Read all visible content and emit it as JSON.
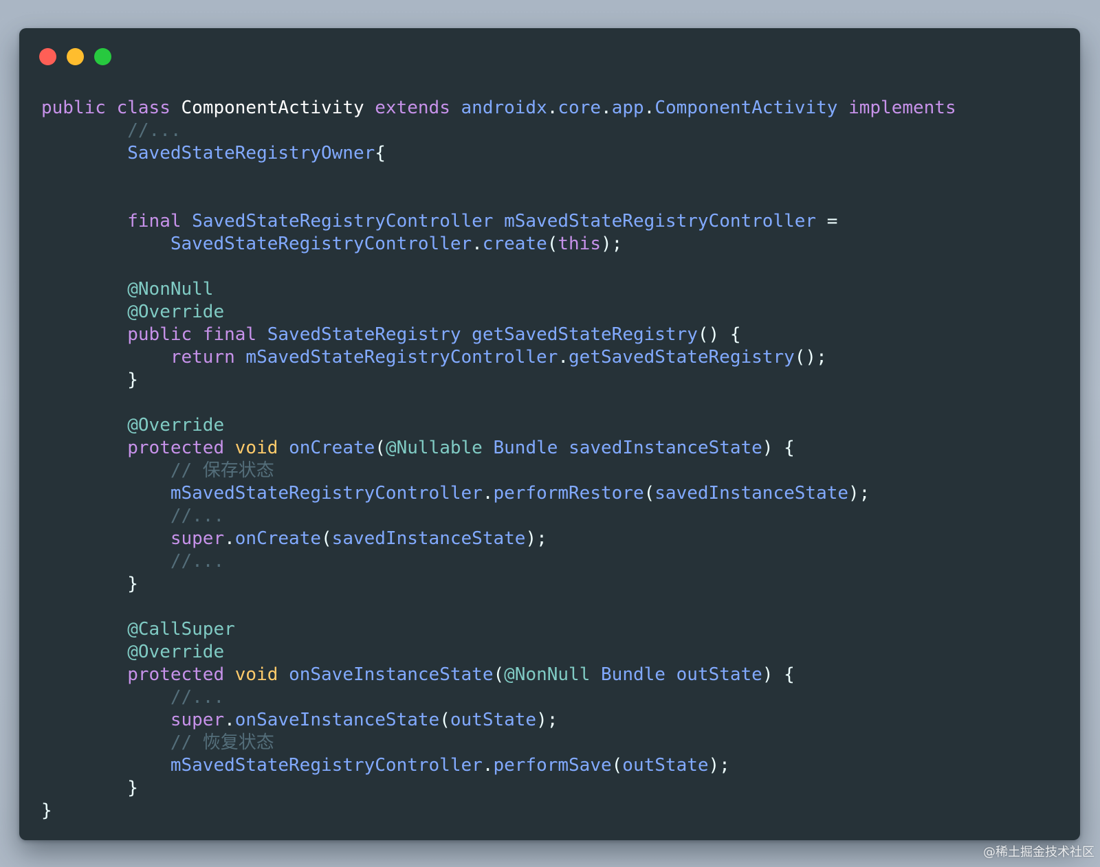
{
  "window": {
    "controls": [
      "close",
      "minimize",
      "maximize"
    ],
    "colors": {
      "background": "#263238",
      "keyword": "#c792ea",
      "type": "#82aaff",
      "annotation": "#80cbc4",
      "void": "#ffcb6b",
      "comment": "#546e7a",
      "plain": "#eeffff"
    }
  },
  "code": {
    "l1": {
      "public": "public",
      "class": "class",
      "name": "ComponentActivity",
      "extends": "extends",
      "pkg1": "androidx",
      "dot1": ".",
      "pkg2": "core",
      "dot2": ".",
      "pkg3": "app",
      "dot3": ".",
      "super_name": "ComponentActivity",
      "implements": "implements"
    },
    "l2": {
      "comment": "//..."
    },
    "l3": {
      "type": "SavedStateRegistryOwner",
      "brace": "{"
    },
    "l4": {
      "final": "final",
      "type": "SavedStateRegistryController",
      "var": "mSavedStateRegistryController",
      "eq": "="
    },
    "l5": {
      "type": "SavedStateRegistryController",
      "dot": ".",
      "fn": "create",
      "open": "(",
      "this": "this",
      "close": ");"
    },
    "l6": {
      "annotation": "@NonNull"
    },
    "l7": {
      "annotation": "@Override"
    },
    "l8": {
      "public": "public",
      "final": "final",
      "type": "SavedStateRegistry",
      "fn": "getSavedStateRegistry",
      "rest": "() {"
    },
    "l9": {
      "return": "return",
      "var": "mSavedStateRegistryController",
      "dot": ".",
      "fn": "getSavedStateRegistry",
      "rest": "();"
    },
    "l10": {
      "brace": "}"
    },
    "l11": {
      "annotation": "@Override"
    },
    "l12": {
      "protected": "protected",
      "void": "void",
      "fn": "onCreate",
      "open": "(",
      "annotation": "@Nullable",
      "type": "Bundle",
      "param": "savedInstanceState",
      "rest": ") {"
    },
    "l13": {
      "comment": "// 保存状态"
    },
    "l14": {
      "var": "mSavedStateRegistryController",
      "dot": ".",
      "fn": "performRestore",
      "open": "(",
      "param": "savedInstanceState",
      "close": ");"
    },
    "l15": {
      "comment": "//..."
    },
    "l16": {
      "super": "super",
      "dot": ".",
      "fn": "onCreate",
      "open": "(",
      "param": "savedInstanceState",
      "close": ");"
    },
    "l17": {
      "comment": "//..."
    },
    "l18": {
      "brace": "}"
    },
    "l19": {
      "annotation": "@CallSuper"
    },
    "l20": {
      "annotation": "@Override"
    },
    "l21": {
      "protected": "protected",
      "void": "void",
      "fn": "onSaveInstanceState",
      "open": "(",
      "annotation": "@NonNull",
      "type": "Bundle",
      "param": "outState",
      "rest": ") {"
    },
    "l22": {
      "comment": "//..."
    },
    "l23": {
      "super": "super",
      "dot": ".",
      "fn": "onSaveInstanceState",
      "open": "(",
      "param": "outState",
      "close": ");"
    },
    "l24": {
      "comment": "// 恢复状态"
    },
    "l25": {
      "var": "mSavedStateRegistryController",
      "dot": ".",
      "fn": "performSave",
      "open": "(",
      "param": "outState",
      "close": ");"
    },
    "l26": {
      "brace": "}"
    },
    "l27": {
      "brace": "}"
    }
  },
  "watermark": "@稀土掘金技术社区"
}
